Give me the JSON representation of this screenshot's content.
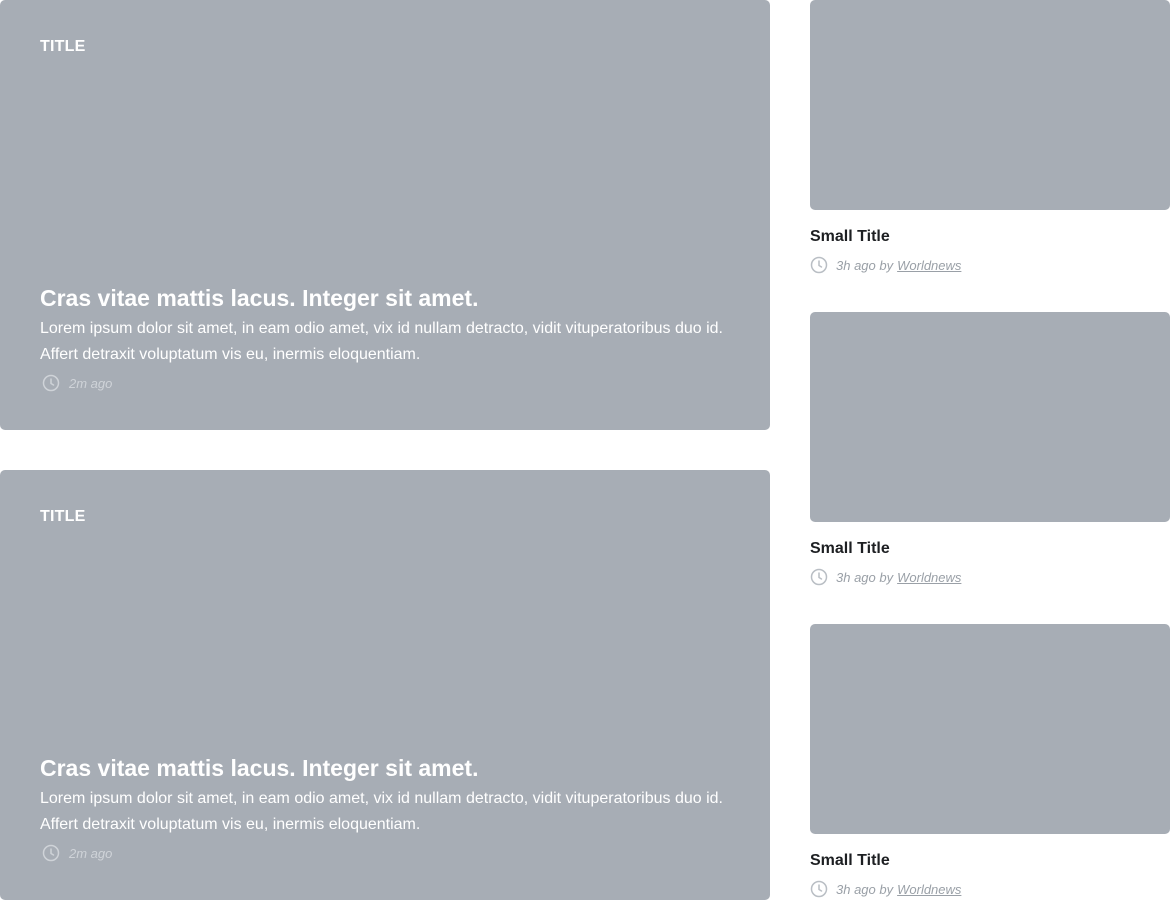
{
  "featured": [
    {
      "label": "TITLE",
      "headline": "Cras vitae mattis lacus. Integer sit amet.",
      "description": "Lorem ipsum dolor sit amet, in eam odio amet, vix id nullam detracto, vidit vituperatoribus duo id. Affert detraxit voluptatum vis eu, inermis eloquentiam.",
      "time": "2m ago",
      "icon": "clock-icon"
    },
    {
      "label": "TITLE",
      "headline": "Cras vitae mattis lacus. Integer sit amet.",
      "description": "Lorem ipsum dolor sit amet, in eam odio amet, vix id nullam detracto, vidit vituperatoribus duo id. Affert detraxit voluptatum vis eu, inermis eloquentiam.",
      "time": "2m ago",
      "icon": "clock-icon"
    }
  ],
  "sidebar": [
    {
      "title": "Small Title",
      "time": "3h ago by",
      "author": "Worldnews",
      "icon": "clock-icon"
    },
    {
      "title": "Small Title",
      "time": "3h ago by",
      "author": "Worldnews",
      "icon": "clock-icon"
    },
    {
      "title": "Small Title",
      "time": "3h ago by",
      "author": "Worldnews",
      "icon": "clock-icon"
    }
  ],
  "colors": {
    "card_background": "#a7adb5",
    "card_text": "#ffffff",
    "small_title": "#1d1f22",
    "meta_text": "#9aa0a7"
  }
}
